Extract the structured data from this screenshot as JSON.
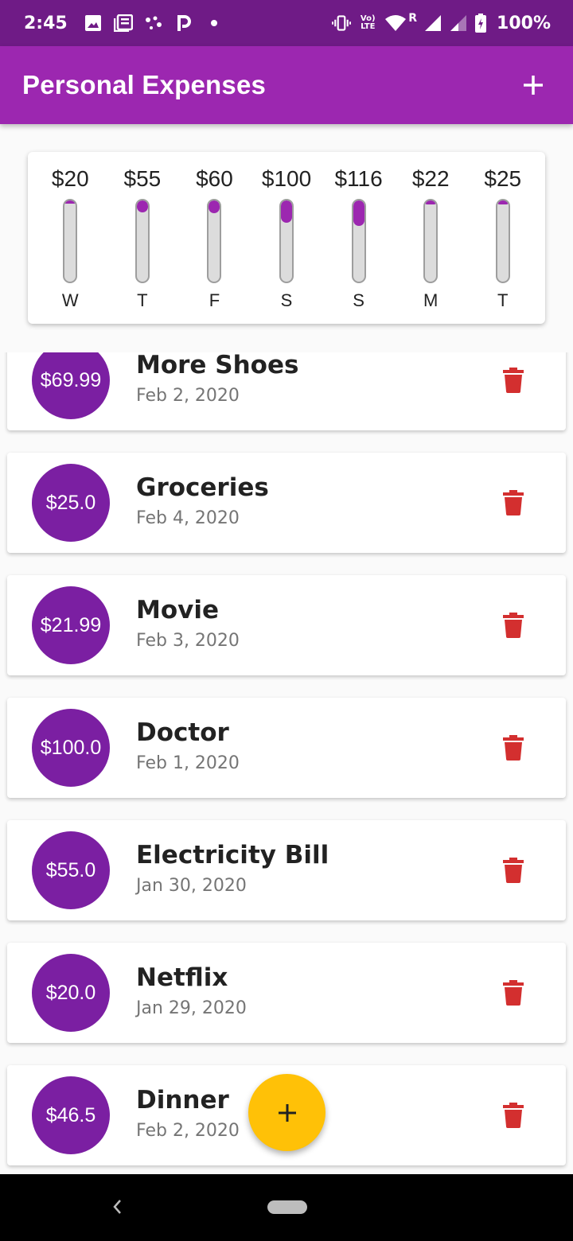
{
  "status_bar": {
    "time": "2:45",
    "battery": "100%",
    "lte_top": "Vo)",
    "lte_bottom": "LTE",
    "roaming": "R"
  },
  "app_bar": {
    "title": "Personal Expenses",
    "add_icon": "plus-icon"
  },
  "chart_data": {
    "type": "bar",
    "categories": [
      "W",
      "T",
      "F",
      "S",
      "S",
      "M",
      "T"
    ],
    "labels": [
      "$20",
      "$55",
      "$60",
      "$100",
      "$116",
      "$22",
      "$25"
    ],
    "values": [
      20,
      55,
      60,
      100,
      116,
      22,
      25
    ],
    "fill_fraction": [
      0.04,
      0.15,
      0.16,
      0.27,
      0.31,
      0.05,
      0.05
    ],
    "color": "#9c27b0"
  },
  "expenses": [
    {
      "amount": "$69.99",
      "title": "More Shoes",
      "date": "Feb 2, 2020"
    },
    {
      "amount": "$25.0",
      "title": "Groceries",
      "date": "Feb 4, 2020"
    },
    {
      "amount": "$21.99",
      "title": "Movie",
      "date": "Feb 3, 2020"
    },
    {
      "amount": "$100.0",
      "title": "Doctor",
      "date": "Feb 1, 2020"
    },
    {
      "amount": "$55.0",
      "title": "Electricity Bill",
      "date": "Jan 30, 2020"
    },
    {
      "amount": "$20.0",
      "title": "Netflix",
      "date": "Jan 29, 2020"
    },
    {
      "amount": "$46.5",
      "title": "Dinner",
      "date": "Feb 2, 2020"
    }
  ],
  "colors": {
    "status_bar": "#6f1b86",
    "app_bar": "#9c27b0",
    "amount_circle": "#7b1fa2",
    "delete": "#d32f2f",
    "fab": "#ffc107"
  },
  "icons": {
    "delete": "trash-icon",
    "fab": "plus-icon",
    "nav_back": "back-chevron-icon"
  }
}
